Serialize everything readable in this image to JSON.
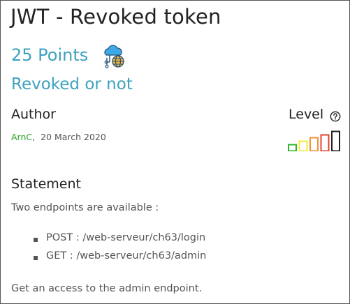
{
  "challenge": {
    "title": "JWT - Revoked token",
    "points": "25 Points",
    "subtitle": "Revoked or not",
    "category_icon": "cloud-network-globe-icon"
  },
  "author": {
    "heading": "Author",
    "name": "ArnC",
    "separator": ",",
    "date": "20 March 2020"
  },
  "level": {
    "heading": "Level",
    "help_icon": "question-circle-icon",
    "current": 1,
    "max": 5,
    "colors": [
      "#2bb52b",
      "#f2ee3a",
      "#f0913a",
      "#e0442f",
      "#222222"
    ]
  },
  "statement": {
    "heading": "Statement",
    "intro": "Two endpoints are available :",
    "endpoints": [
      "POST : /web-serveur/ch63/login",
      "GET : /web-serveur/ch63/admin"
    ],
    "goal": "Get an access to the admin endpoint."
  },
  "colors": {
    "accent": "#3ea2bd",
    "author_link": "#2ca52c",
    "text_muted": "#555555"
  }
}
